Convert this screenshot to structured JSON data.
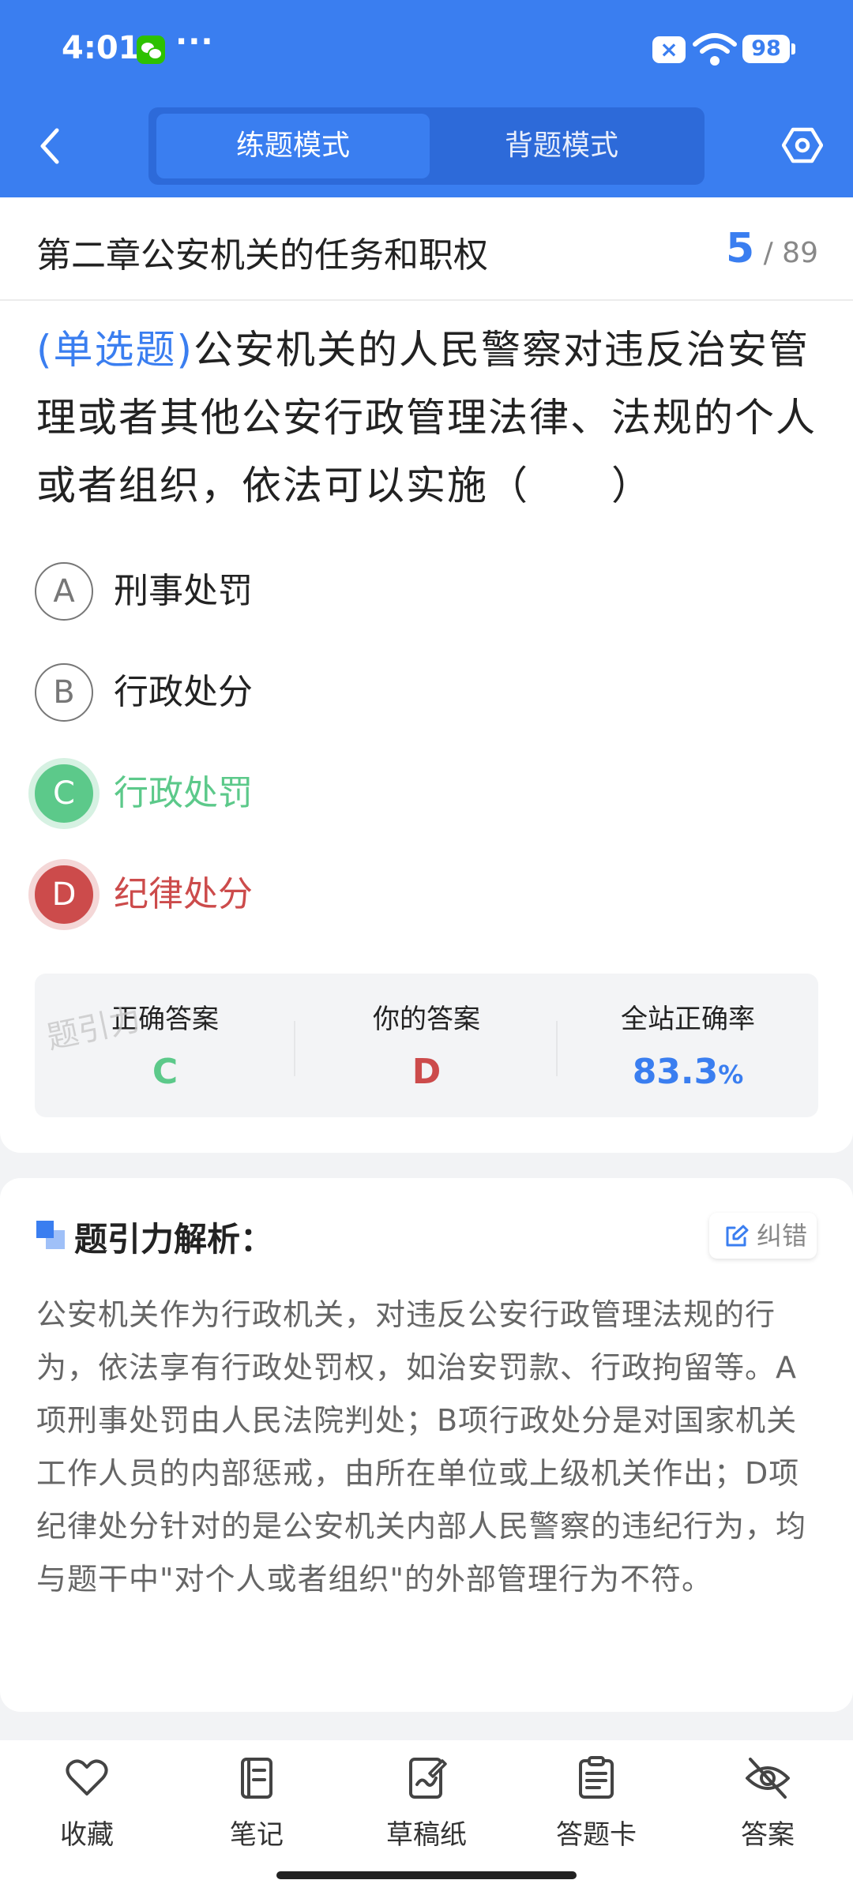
{
  "status_bar": {
    "time": "4:01",
    "overflow": "···",
    "battery": "98"
  },
  "header": {
    "tabs": [
      {
        "label": "练题模式",
        "active": true
      },
      {
        "label": "背题模式",
        "active": false
      }
    ],
    "accent_color": "#3a7ef0"
  },
  "question": {
    "chapter": "第二章公安机关的任务和职权",
    "current": "5",
    "total": "/ 89",
    "type_label": "(单选题)",
    "text": "公安机关的人民警察对违反治安管理或者其他公安行政管理法律、法规的个人或者组织，依法可以实施（　　）",
    "options": [
      {
        "letter": "A",
        "text": "刑事处罚",
        "state": "normal"
      },
      {
        "letter": "B",
        "text": "行政处分",
        "state": "normal"
      },
      {
        "letter": "C",
        "text": "行政处罚",
        "state": "correct"
      },
      {
        "letter": "D",
        "text": "纪律处分",
        "state": "wrong"
      }
    ]
  },
  "answer_summary": {
    "watermark": "题引力",
    "correct_label": "正确答案",
    "correct_value": "C",
    "yours_label": "你的答案",
    "yours_value": "D",
    "rate_label": "全站正确率",
    "rate_value": "83.3",
    "rate_unit": "%",
    "correct_color": "#5cc98a",
    "wrong_color": "#cc4b4b"
  },
  "analysis": {
    "title": "题引力解析：",
    "correction_label": "纠错",
    "text": "公安机关作为行政机关，对违反公安行政管理法规的行为，依法享有行政处罚权，如治安罚款、行政拘留等。A项刑事处罚由人民法院判处；B项行政处分是对国家机关工作人员的内部惩戒，由所在单位或上级机关作出；D项纪律处分针对的是公安机关内部人民警察的违纪行为，均与题干中\"对个人或者组织\"的外部管理行为不符。"
  },
  "bottom_nav": {
    "favorite": "收藏",
    "notes": "笔记",
    "scratch": "草稿纸",
    "answer_card": "答题卡",
    "answer": "答案"
  }
}
